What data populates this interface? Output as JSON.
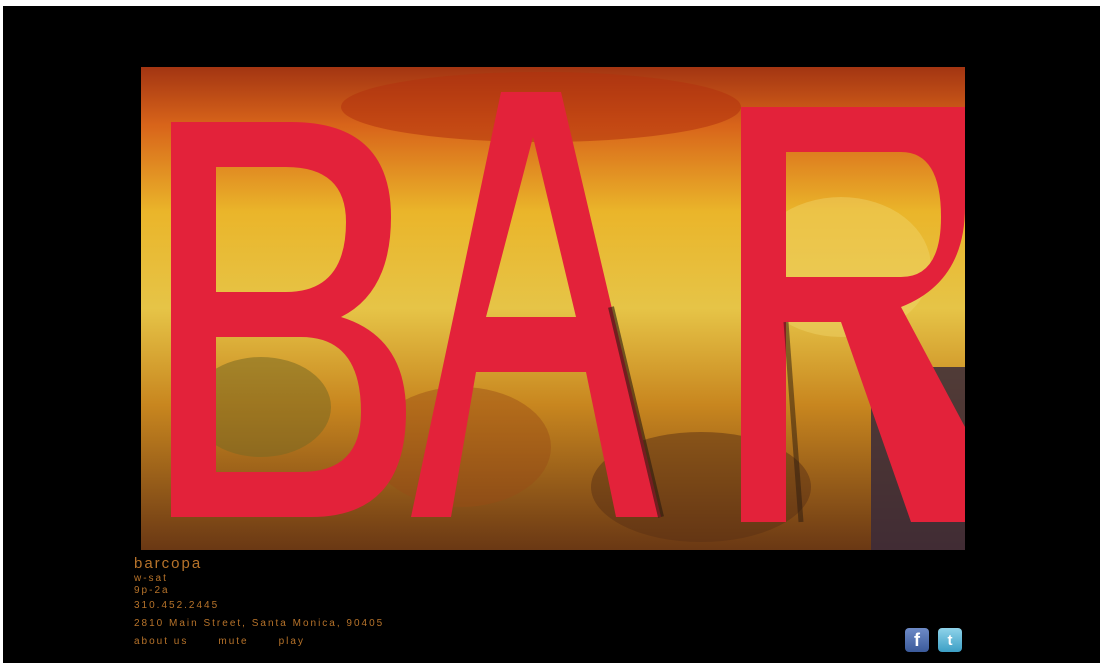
{
  "site": {
    "name": "barcopa",
    "days": "w-sat",
    "hours": "9p-2a",
    "phone": "310.452.2445",
    "address": "2810 Main Street, Santa Monica, 90405"
  },
  "hero_image": {
    "description_icon": "bar-sign-photo",
    "colors": {
      "letters": "#e3223a",
      "background_light": "#e8c53b",
      "background_dark": "#5a2f12"
    }
  },
  "nav": {
    "about_label": "about us",
    "mute_label": "mute",
    "play_label": "play"
  },
  "social": {
    "facebook_icon": "facebook-icon",
    "facebook_glyph": "f",
    "twitter_icon": "twitter-icon",
    "twitter_glyph": "t"
  },
  "colors": {
    "page_bg": "#000000",
    "text_accent": "#b7732a"
  }
}
